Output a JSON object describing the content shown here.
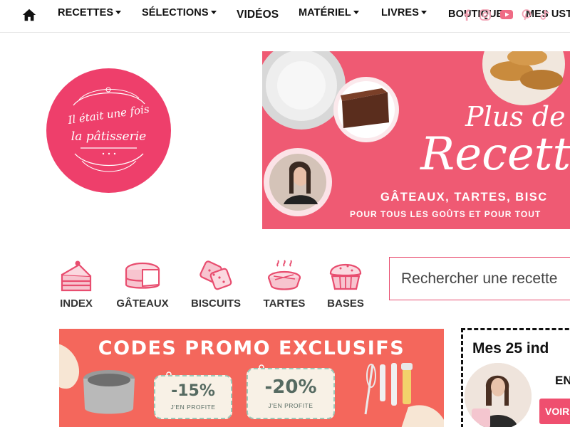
{
  "nav": {
    "home_icon": "home-icon",
    "items": [
      {
        "label": "RECETTES",
        "dropdown": true
      },
      {
        "label": "SÉLECTIONS",
        "dropdown": true
      },
      {
        "label": "VIDÉOS",
        "dropdown": false
      },
      {
        "label": "MATÉRIEL",
        "dropdown": true
      },
      {
        "label": "LIVRES",
        "dropdown": true
      },
      {
        "label": "BOUTIQUE",
        "dropdown": false
      },
      {
        "label": "MES UST",
        "dropdown": false
      }
    ],
    "social_icons": [
      "facebook-icon",
      "instagram-icon",
      "youtube-icon",
      "pinterest-icon",
      "tiktok-icon"
    ]
  },
  "logo": {
    "line1": "Il était une fois",
    "line2": "la pâtisserie",
    "color": "#ee3f6b"
  },
  "banner": {
    "title_line1": "Plus de",
    "title_line2": "Recett",
    "subtitle1": "GÂTEAUX, TARTES, BISC",
    "subtitle2": "POUR TOUS LES GOÛTS ET POUR TOUT",
    "color": "#ef5a73"
  },
  "categories": [
    {
      "label": "INDEX",
      "icon": "cake-slice-icon"
    },
    {
      "label": "GÂTEAUX",
      "icon": "round-cake-icon"
    },
    {
      "label": "BISCUITS",
      "icon": "biscuits-icon"
    },
    {
      "label": "TARTES",
      "icon": "pie-icon"
    },
    {
      "label": "BASES",
      "icon": "muffin-icon"
    }
  ],
  "search": {
    "placeholder": "Rechercher une recette"
  },
  "promo": {
    "title": "CODES PROMO EXCLUSIFS",
    "coupons": [
      {
        "value": "-15%",
        "label": "J'EN PROFITE"
      },
      {
        "value": "-20%",
        "label": "J'EN PROFITE"
      }
    ],
    "color": "#f4675c"
  },
  "top25": {
    "title": "Mes 25 ind",
    "partial_text": "EN",
    "button_label": "VOIR"
  },
  "accent_color": "#e84d6f"
}
